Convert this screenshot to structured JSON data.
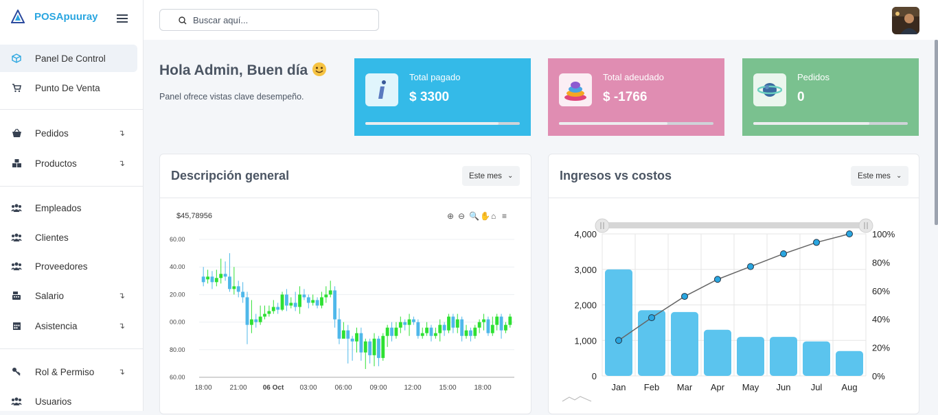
{
  "brand": {
    "name": "POSApuuray"
  },
  "sidebar": {
    "items": [
      {
        "label": "Panel De Control",
        "icon": "cube-icon",
        "expandable": false,
        "active": true
      },
      {
        "label": "Punto De Venta",
        "icon": "cart-icon",
        "expandable": false
      },
      {
        "label": "Pedidos",
        "icon": "basket-icon",
        "expandable": true
      },
      {
        "label": "Productos",
        "icon": "boxes-icon",
        "expandable": true
      },
      {
        "label": "Empleados",
        "icon": "users-icon",
        "expandable": false
      },
      {
        "label": "Clientes",
        "icon": "users-icon",
        "expandable": false
      },
      {
        "label": "Proveedores",
        "icon": "users-icon",
        "expandable": false
      },
      {
        "label": "Salario",
        "icon": "cash-register-icon",
        "expandable": true
      },
      {
        "label": "Asistencia",
        "icon": "calendar-icon",
        "expandable": true
      },
      {
        "label": "Rol & Permiso",
        "icon": "key-icon",
        "expandable": true
      },
      {
        "label": "Usuarios",
        "icon": "users-icon",
        "expandable": false
      }
    ],
    "expand_glyph": "↴"
  },
  "search": {
    "placeholder": "Buscar aquí..."
  },
  "greeting": {
    "title": "Hola Admin, Buen día",
    "subtitle": "Panel ofrece vistas clave desempeño."
  },
  "stats": [
    {
      "title": "Total pagado",
      "value": "$ 3300",
      "color": "#34bae8",
      "icon": "info-icon",
      "progress": 0.86
    },
    {
      "title": "Total adeudado",
      "value": "$ -1766",
      "color": "#e08db2",
      "icon": "stack-icon",
      "progress": 0.7
    },
    {
      "title": "Pedidos",
      "value": "0",
      "color": "#7ac18f",
      "icon": "planet-icon",
      "progress": 0.75
    }
  ],
  "overview": {
    "title": "Descripción general",
    "filter": "Este mes",
    "chevron": "⌄"
  },
  "revenue": {
    "title": "Ingresos vs costos",
    "filter": "Este mes",
    "chevron": "⌄"
  },
  "chart_data": [
    {
      "type": "candlestick",
      "label": "$45,78956",
      "y_ticks": [
        "60.00",
        "40.00",
        "20.00",
        "00.00",
        "80.00",
        "60.00"
      ],
      "x_ticks": [
        "18:00",
        "21:00",
        "06 Oct",
        "03:00",
        "06:00",
        "09:00",
        "12:00",
        "15:00",
        "18:00"
      ],
      "candles": [
        [
          33,
          29,
          40,
          26
        ],
        [
          31,
          33,
          38,
          28
        ],
        [
          33,
          29,
          37,
          24
        ],
        [
          29,
          32,
          38,
          26
        ],
        [
          32,
          35,
          46,
          28
        ],
        [
          35,
          33,
          44,
          30
        ],
        [
          33,
          24,
          50,
          22
        ],
        [
          24,
          26,
          40,
          20
        ],
        [
          26,
          22,
          30,
          18
        ],
        [
          22,
          18,
          29,
          14
        ],
        [
          18,
          -2,
          22,
          -16
        ],
        [
          -2,
          2,
          16,
          -8
        ],
        [
          2,
          0,
          6,
          -4
        ],
        [
          0,
          4,
          12,
          -2
        ],
        [
          4,
          6,
          12,
          2
        ],
        [
          6,
          8,
          12,
          4
        ],
        [
          8,
          11,
          16,
          6
        ],
        [
          11,
          9,
          14,
          6
        ],
        [
          9,
          20,
          22,
          8
        ],
        [
          20,
          12,
          24,
          8
        ],
        [
          12,
          14,
          18,
          10
        ],
        [
          14,
          11,
          22,
          8
        ],
        [
          11,
          20,
          26,
          6
        ],
        [
          20,
          18,
          24,
          16
        ],
        [
          18,
          14,
          20,
          10
        ],
        [
          14,
          16,
          20,
          12
        ],
        [
          16,
          12,
          18,
          10
        ],
        [
          12,
          18,
          22,
          10
        ],
        [
          18,
          20,
          26,
          14
        ],
        [
          20,
          23,
          30,
          18
        ],
        [
          23,
          2,
          26,
          -4
        ],
        [
          2,
          -12,
          10,
          -16
        ],
        [
          -12,
          -6,
          0,
          -10
        ],
        [
          -6,
          -12,
          -2,
          -30
        ],
        [
          -12,
          -14,
          -10,
          -28
        ],
        [
          -14,
          -8,
          -4,
          -22
        ],
        [
          -8,
          -22,
          -4,
          -28
        ],
        [
          -22,
          -14,
          -12,
          -34
        ],
        [
          -14,
          -24,
          -12,
          -30
        ],
        [
          -24,
          -12,
          -8,
          -32
        ],
        [
          -12,
          -26,
          -10,
          -32
        ],
        [
          -26,
          -10,
          -8,
          -28
        ],
        [
          -10,
          -4,
          -2,
          -18
        ],
        [
          -4,
          -10,
          0,
          -14
        ],
        [
          -10,
          -4,
          0,
          -12
        ],
        [
          -4,
          0,
          4,
          -8
        ],
        [
          0,
          -2,
          2,
          -6
        ],
        [
          -2,
          2,
          6,
          -10
        ],
        [
          2,
          0,
          4,
          -2
        ],
        [
          0,
          -10,
          2,
          -12
        ],
        [
          -10,
          -8,
          -4,
          -12
        ],
        [
          -8,
          -4,
          0,
          -10
        ],
        [
          -4,
          -10,
          -2,
          -14
        ],
        [
          -10,
          -8,
          -4,
          -12
        ],
        [
          -8,
          -2,
          2,
          -14
        ],
        [
          -2,
          -6,
          0,
          -10
        ],
        [
          -6,
          4,
          6,
          -8
        ],
        [
          4,
          -4,
          6,
          -8
        ],
        [
          -4,
          2,
          6,
          -8
        ],
        [
          2,
          -10,
          4,
          -14
        ],
        [
          -10,
          -6,
          -2,
          -12
        ],
        [
          -6,
          -10,
          -4,
          -14
        ],
        [
          -10,
          -4,
          -2,
          -12
        ],
        [
          -4,
          0,
          2,
          -8
        ],
        [
          0,
          2,
          6,
          -6
        ],
        [
          2,
          -8,
          4,
          -10
        ],
        [
          -8,
          -2,
          4,
          -10
        ],
        [
          -2,
          4,
          6,
          -6
        ],
        [
          4,
          -6,
          6,
          -12
        ],
        [
          -6,
          -2,
          0,
          -8
        ],
        [
          -2,
          4,
          6,
          -4
        ]
      ]
    },
    {
      "type": "pareto",
      "categories": [
        "Jan",
        "Feb",
        "Mar",
        "Apr",
        "May",
        "Jun",
        "Jul",
        "Aug"
      ],
      "values": [
        3000,
        1850,
        1800,
        1300,
        1100,
        1100,
        970,
        700
      ],
      "cumulative_pct": [
        25,
        41,
        56,
        68,
        77,
        86,
        94,
        100
      ],
      "y_ticks": [
        "4,000",
        "3,000",
        "2,000",
        "1,000",
        "0"
      ],
      "y2_ticks": [
        "100%",
        "80%",
        "60%",
        "40%",
        "20%",
        "0%"
      ],
      "ylim": [
        0,
        4000
      ],
      "y2lim": [
        0,
        100
      ],
      "bar_color": "#5bc4ee",
      "line_color": "#666666",
      "point_color": "#2aa6e0"
    }
  ]
}
